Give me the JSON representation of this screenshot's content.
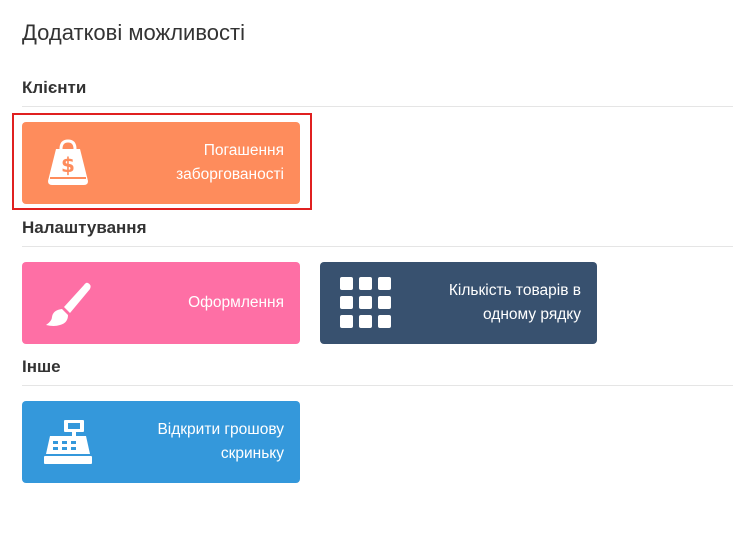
{
  "page": {
    "title": "Додаткові можливості"
  },
  "sections": [
    {
      "heading": "Клієнти",
      "tiles": [
        {
          "label": "Погашення заборгованості",
          "icon": "money-bag-icon",
          "color": "#fe8c5c",
          "highlighted": true
        }
      ]
    },
    {
      "heading": "Налаштування",
      "tiles": [
        {
          "label": "Оформлення",
          "icon": "paint-brush-icon",
          "color": "#fe6fa5"
        },
        {
          "label": "Кількість товарів в одному рядку",
          "icon": "grid-icon",
          "color": "#38516f"
        }
      ]
    },
    {
      "heading": "Інше",
      "tiles": [
        {
          "label": "Відкрити грошову скриньку",
          "icon": "cash-register-icon",
          "color": "#3498db"
        }
      ]
    }
  ],
  "highlight": {
    "color": "#e02020"
  }
}
